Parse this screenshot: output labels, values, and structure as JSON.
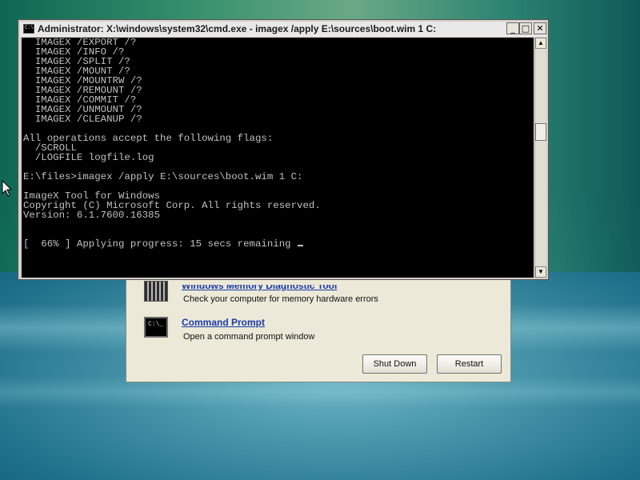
{
  "console_window": {
    "title": "Administrator: X:\\windows\\system32\\cmd.exe - imagex  /apply E:\\sources\\boot.wim 1 C:",
    "icon_label": "C:\\",
    "controls": {
      "minimize": "_",
      "maximize": "□",
      "close": "✕"
    },
    "lines": [
      "  IMAGEX /EXPORT /?",
      "  IMAGEX /INFO /?",
      "  IMAGEX /SPLIT /?",
      "  IMAGEX /MOUNT /?",
      "  IMAGEX /MOUNTRW /?",
      "  IMAGEX /REMOUNT /?",
      "  IMAGEX /COMMIT /?",
      "  IMAGEX /UNMOUNT /?",
      "  IMAGEX /CLEANUP /?",
      "",
      "All operations accept the following flags:",
      "  /SCROLL",
      "  /LOGFILE logfile.log",
      "",
      "E:\\files>imagex /apply E:\\sources\\boot.wim 1 C:",
      "",
      "ImageX Tool for Windows",
      "Copyright (C) Microsoft Corp. All rights reserved.",
      "Version: 6.1.7600.16385",
      "",
      "",
      "[  66% ] Applying progress: 15 secs remaining "
    ],
    "scroll_up": "▲",
    "scroll_down": "▼"
  },
  "recovery_options": {
    "memory_tool": {
      "link": "Windows Memory Diagnostic Tool",
      "description": "Check your computer for memory hardware errors",
      "icon": "memory-chip-icon"
    },
    "command_prompt": {
      "link": "Command Prompt",
      "description": "Open a command prompt window",
      "icon": "command-prompt-icon",
      "icon_text": "C:\\_"
    },
    "shutdown_label": "Shut Down",
    "restart_label": "Restart"
  }
}
